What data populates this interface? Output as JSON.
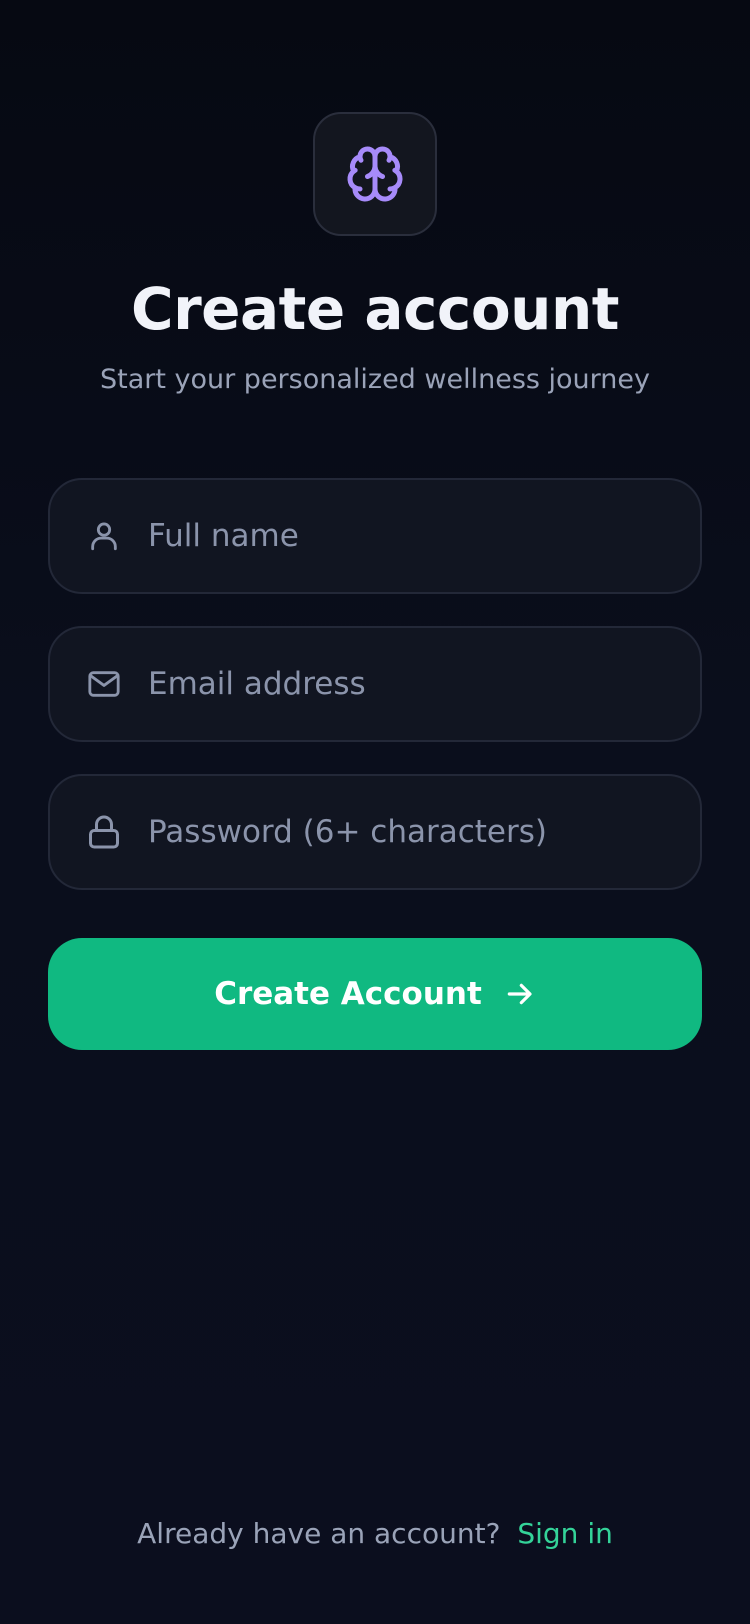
{
  "header": {
    "logo_icon": "brain-icon",
    "logo_color": "#a78bfa",
    "title": "Create account",
    "subtitle": "Start your personalized wellness journey"
  },
  "form": {
    "full_name": {
      "placeholder": "Full name",
      "value": "",
      "icon": "user-icon"
    },
    "email": {
      "placeholder": "Email address",
      "value": "",
      "icon": "mail-icon"
    },
    "password": {
      "placeholder": "Password (6+ characters)",
      "value": "",
      "icon": "lock-icon"
    },
    "submit": {
      "label": "Create Account",
      "icon": "arrow-right-icon",
      "color": "#10b981"
    }
  },
  "footer": {
    "prompt": "Already have an account?",
    "link": "Sign in",
    "link_color": "#34d399"
  }
}
